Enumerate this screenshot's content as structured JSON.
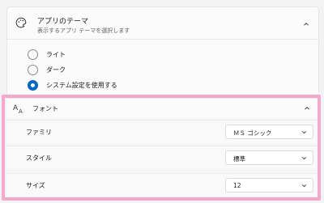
{
  "theme": {
    "title": "アプリのテーマ",
    "description": "表示するアプリ テーマを選択します",
    "options": [
      {
        "label": "ライト",
        "selected": false
      },
      {
        "label": "ダーク",
        "selected": false
      },
      {
        "label": "システム設定を使用する",
        "selected": true
      }
    ]
  },
  "font": {
    "title": "フォント",
    "settings": [
      {
        "label": "ファミリ",
        "value": "ＭＳ ゴシック"
      },
      {
        "label": "スタイル",
        "value": "標準"
      },
      {
        "label": "サイズ",
        "value": "12"
      }
    ]
  },
  "colors": {
    "accent": "#0067c0",
    "highlight": "#f3a9cc"
  }
}
